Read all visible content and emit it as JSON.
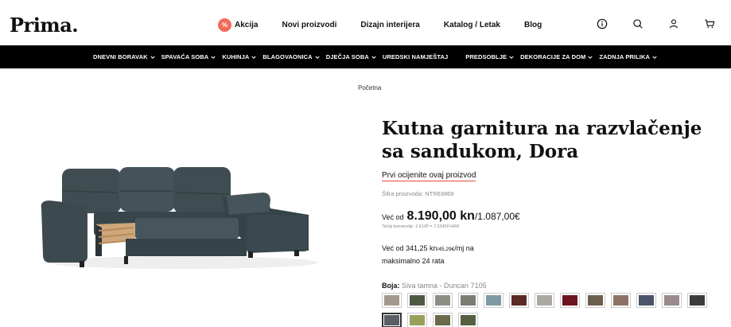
{
  "header": {
    "logo": "Prima.",
    "nav": [
      {
        "label": "Akcija",
        "badge": "%"
      },
      {
        "label": "Novi proizvodi"
      },
      {
        "label": "Dizajn interijera"
      },
      {
        "label": "Katalog / Letak"
      },
      {
        "label": "Blog"
      }
    ],
    "icons": [
      "info-icon",
      "search-icon",
      "user-icon",
      "cart-icon"
    ]
  },
  "categories": [
    {
      "label": "DNEVNI BORAVAK",
      "dropdown": true
    },
    {
      "label": "SPAVAĆA SOBA",
      "dropdown": true
    },
    {
      "label": "KUHINJA",
      "dropdown": true
    },
    {
      "label": "BLAGOVAONICA",
      "dropdown": true
    },
    {
      "label": "DJEČJA SOBA",
      "dropdown": true
    },
    {
      "label": "UREDSKI NAMJEŠTAJ",
      "dropdown": false
    },
    {
      "label": "PREDSOBLJE",
      "dropdown": true
    },
    {
      "label": "DEKORACIJE ZA DOM",
      "dropdown": true
    },
    {
      "label": "ZADNJA PRILIKA",
      "dropdown": true
    }
  ],
  "breadcrumb": "Početna",
  "product": {
    "title": "Kutna garnitura na razvlačenje sa sandukom, Dora",
    "rate_link": "Prvi ocijenite ovaj proizvod",
    "sku": "Šifra proizvoda: NTR63869",
    "price_from": "Već od",
    "price_main": "8.190,00 kn",
    "price_sep": "/",
    "price_eur": "1.087,00€",
    "conversion": "Tečaj konverzije: 1 EUR = 7,53450 HRK",
    "installment_pre": "Već od 341,25 kn",
    "installment_small": "/45,29€",
    "installment_post": "/mj na",
    "installment_line2": "maksimalno 24 rata",
    "color_label": "Boja:",
    "color_value": "Siva tamna - Duncan 7105"
  },
  "colors": {
    "sofa_main": "#3c4a4f",
    "accent_badge": "#f26b5b",
    "link_underline": "#e14a3a"
  },
  "swatches": [
    {
      "color": "#a39a8e",
      "selected": false
    },
    {
      "color": "#4f5a43",
      "selected": false
    },
    {
      "color": "#8d8e86",
      "selected": false
    },
    {
      "color": "#7a7e74",
      "selected": false
    },
    {
      "color": "#7f9aa4",
      "selected": false
    },
    {
      "color": "#5a2a25",
      "selected": false
    },
    {
      "color": "#aba9a2",
      "selected": false
    },
    {
      "color": "#6e1320",
      "selected": false
    },
    {
      "color": "#6b604f",
      "selected": false
    },
    {
      "color": "#8b7466",
      "selected": false
    },
    {
      "color": "#4a5569",
      "selected": false
    },
    {
      "color": "#9a8a8c",
      "selected": false
    },
    {
      "color": "#3b3d3a",
      "selected": false
    },
    {
      "color": "#5b5e63",
      "selected": true
    },
    {
      "color": "#9aa05a",
      "selected": false
    },
    {
      "color": "#6b6a4a",
      "selected": false
    },
    {
      "color": "#556040",
      "selected": false
    }
  ]
}
